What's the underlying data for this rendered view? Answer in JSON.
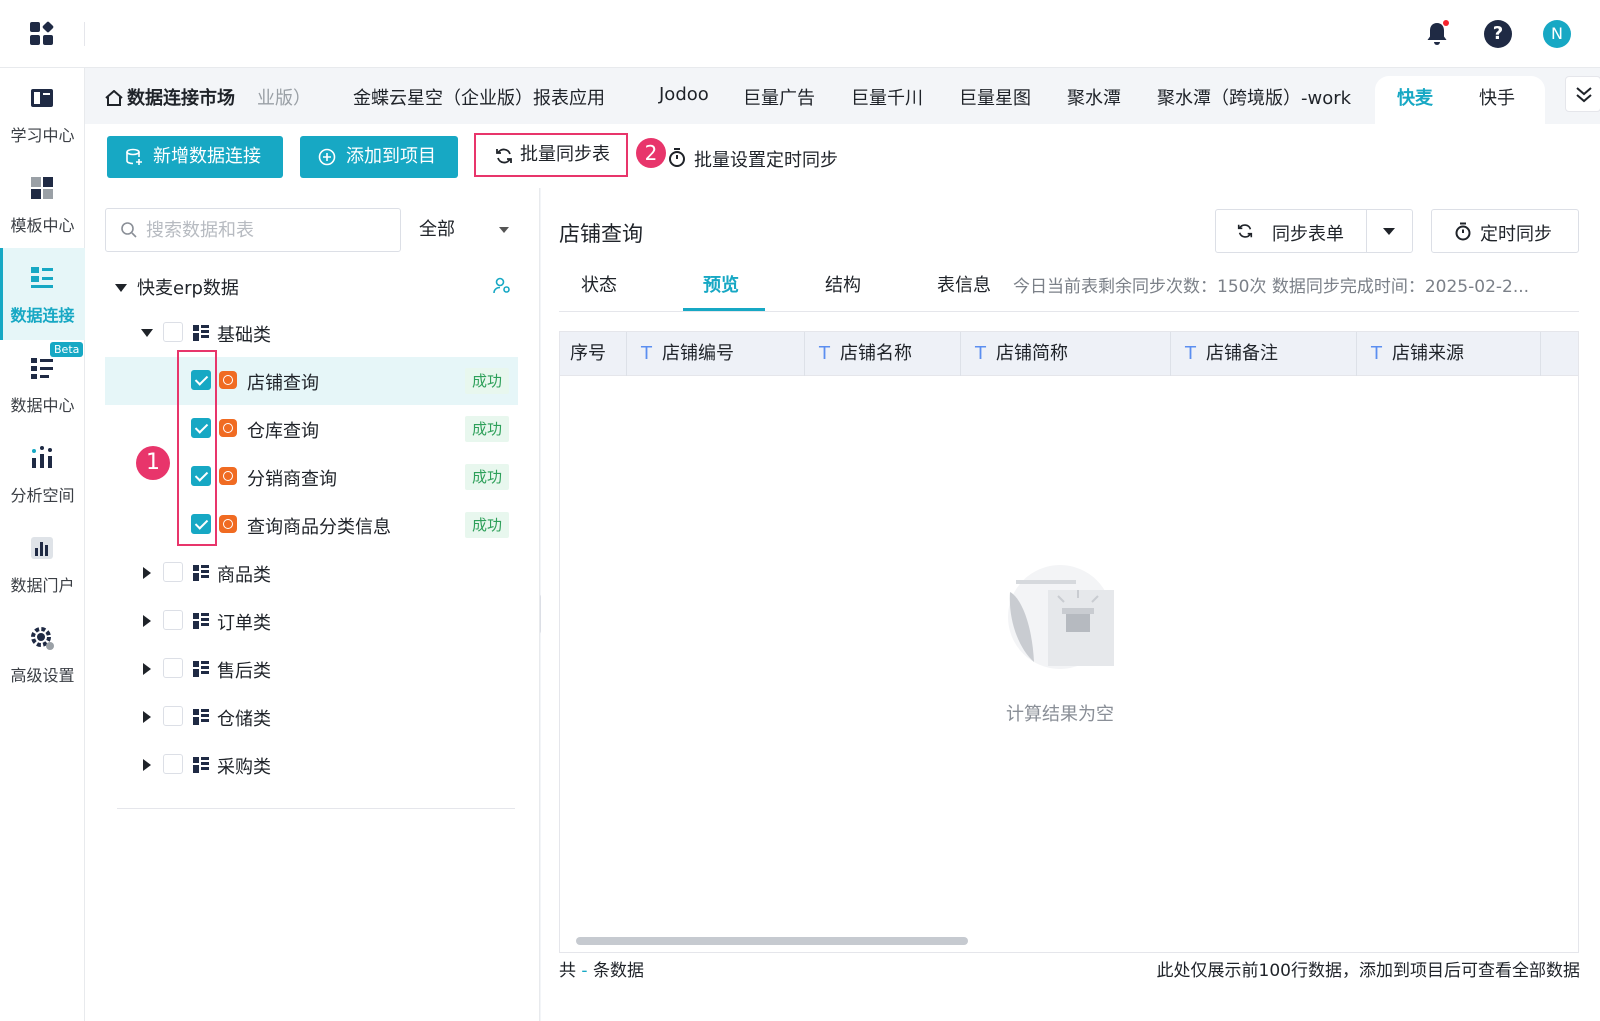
{
  "topbar": {
    "avatar_letter": "N",
    "help_glyph": "?"
  },
  "nav": [
    {
      "label": "学习中心",
      "icon": "book-icon"
    },
    {
      "label": "模板中心",
      "icon": "template-icon"
    },
    {
      "label": "数据连接",
      "icon": "data-connect-icon",
      "active": true
    },
    {
      "label": "数据中心",
      "icon": "data-center-icon",
      "badge": "Beta"
    },
    {
      "label": "分析空间",
      "icon": "analysis-icon"
    },
    {
      "label": "数据门户",
      "icon": "portal-icon"
    },
    {
      "label": "高级设置",
      "icon": "gear-icon"
    }
  ],
  "tabs": {
    "home": "数据连接市场",
    "items": [
      "业版）",
      "金蝶云星空（企业版）报表应用",
      "Jodoo",
      "巨量广告",
      "巨量千川",
      "巨量星图",
      "聚水潭",
      "聚水潭（跨境版）-work",
      "快麦",
      "快手"
    ],
    "active": "快麦"
  },
  "toolbar": {
    "add_connection": "新增数据连接",
    "add_to_project": "添加到项目",
    "batch_sync": "批量同步表",
    "batch_timer": "批量设置定时同步",
    "step1": "1",
    "step2": "2"
  },
  "left": {
    "search_placeholder": "搜索数据和表",
    "filter": "全部",
    "root": "快麦erp数据",
    "basic": "基础类",
    "status_ok": "成功",
    "tables": [
      "店铺查询",
      "仓库查询",
      "分销商查询",
      "查询商品分类信息"
    ],
    "groups": [
      "商品类",
      "订单类",
      "售后类",
      "仓储类",
      "采购类"
    ]
  },
  "right": {
    "title": "店铺查询",
    "sync_form": "同步表单",
    "timer_sync": "定时同步",
    "subtabs": [
      "状态",
      "预览",
      "结构",
      "表信息"
    ],
    "active_subtab": "预览",
    "info": "今日当前表剩余同步次数：150次   数据同步完成时间：2025-02-2...",
    "columns": [
      "序号",
      "店铺编号",
      "店铺名称",
      "店铺简称",
      "店铺备注",
      "店铺来源"
    ],
    "col_type": "T",
    "empty": "计算结果为空",
    "footer_prefix": "共",
    "footer_count": "-",
    "footer_suffix": "条数据",
    "footer_note": "此处仅展示前100行数据，添加到项目后可查看全部数据"
  },
  "colors": {
    "accent": "#17a8c4",
    "highlight": "#e8356b",
    "success": "#2ea05a"
  }
}
